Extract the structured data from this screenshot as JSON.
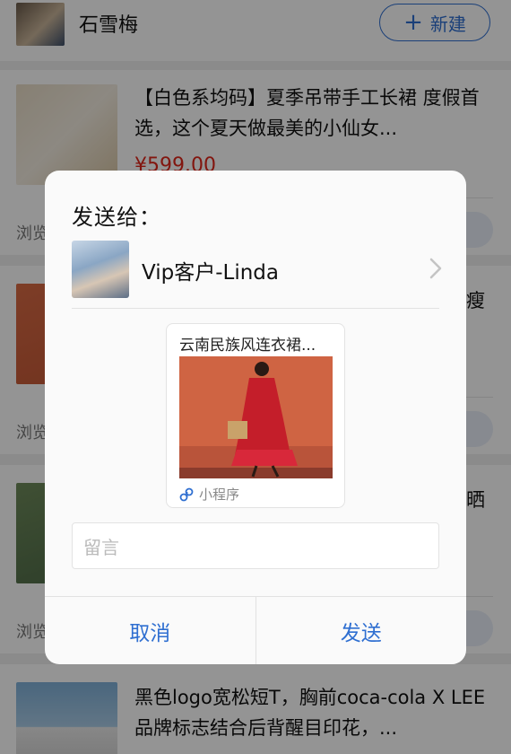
{
  "header": {
    "name": "石雪梅",
    "new_button": "新建",
    "new_icon": "plus-icon"
  },
  "products": [
    {
      "title": "【白色系均码】夏季吊带手工长裙 度假首选，这个夏天做最美的小仙女...",
      "price": "¥599.00",
      "browse": "浏览"
    },
    {
      "title_fragment": "瘦",
      "browse": "浏览"
    },
    {
      "title_fragment": "晒",
      "browse": "浏览"
    },
    {
      "title": "黑色logo宽松短T，胸前coca-cola X LEE品牌标志结合后背醒目印花，..."
    }
  ],
  "dialog": {
    "title": "发送给：",
    "recipient": {
      "name": "Vip客户-Linda",
      "chevron_icon": "chevron-right-icon"
    },
    "mini_program": {
      "title": "云南民族风连衣裙...",
      "footer": "小程序",
      "footer_icon": "mini-program-icon"
    },
    "message_placeholder": "留言",
    "cancel_label": "取消",
    "send_label": "发送"
  },
  "colors": {
    "accent": "#2f6fd1",
    "price": "#e0261b"
  }
}
